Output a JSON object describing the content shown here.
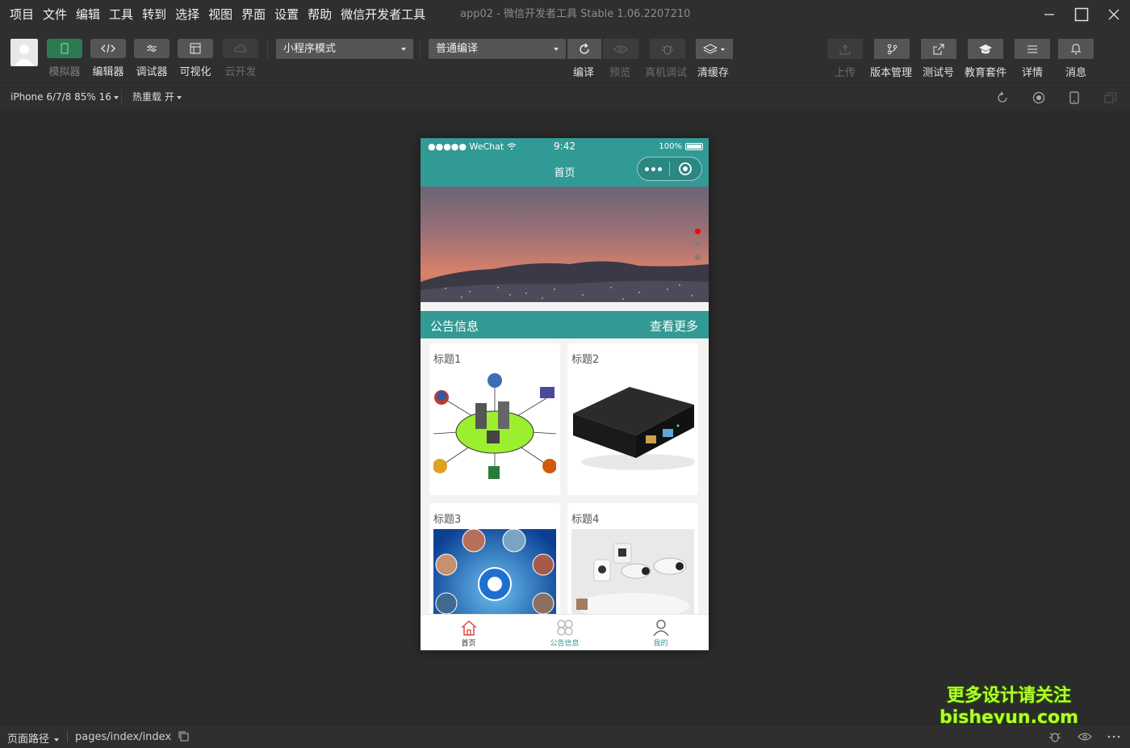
{
  "menu": [
    "项目",
    "文件",
    "编辑",
    "工具",
    "转到",
    "选择",
    "视图",
    "界面",
    "设置",
    "帮助",
    "微信开发者工具"
  ],
  "window_title": "app02 - 微信开发者工具 Stable 1.06.2207210",
  "toolbar": {
    "simulator": "模拟器",
    "editor": "编辑器",
    "debugger": "调试器",
    "visual": "可视化",
    "cloud": "云开发",
    "mode_select": "小程序模式",
    "compile_select": "普通编译",
    "compile": "编译",
    "preview": "预览",
    "remote_debug": "真机调试",
    "clear_cache": "清缓存",
    "upload": "上传",
    "version_mgmt": "版本管理",
    "test_account": "测试号",
    "edu_suite": "教育套件",
    "details": "详情",
    "messages": "消息"
  },
  "devicebar": {
    "device": "iPhone 6/7/8 85% 16",
    "hot_reload": "热重载 开"
  },
  "phone": {
    "status_left": "●●●●● WeChat",
    "time": "9:42",
    "battery": "100%",
    "nav_title": "首页",
    "notice_title": "公告信息",
    "see_more": "查看更多",
    "cards": [
      {
        "title": "标题1",
        "image": "network-diagram-image"
      },
      {
        "title": "标题2",
        "image": "network-device-image"
      },
      {
        "title": "标题3",
        "image": "globe-collage-image"
      },
      {
        "title": "标题4",
        "image": "security-cameras-image"
      }
    ],
    "banner": {
      "slides": 3,
      "active": 1
    },
    "tabs": [
      {
        "label": "首页",
        "icon": "home-icon"
      },
      {
        "label": "公告信息",
        "icon": "grid-icon"
      },
      {
        "label": "我的",
        "icon": "user-icon"
      }
    ]
  },
  "watermark": {
    "line1": "更多设计请关注",
    "line2": "bisheyun.com"
  },
  "bottombar": {
    "page_path_label": "页面路径",
    "page_path": "pages/index/index"
  },
  "colors": {
    "theme": "#329a94",
    "background": "#2b2b2b",
    "active_dot": "#ff0000"
  }
}
